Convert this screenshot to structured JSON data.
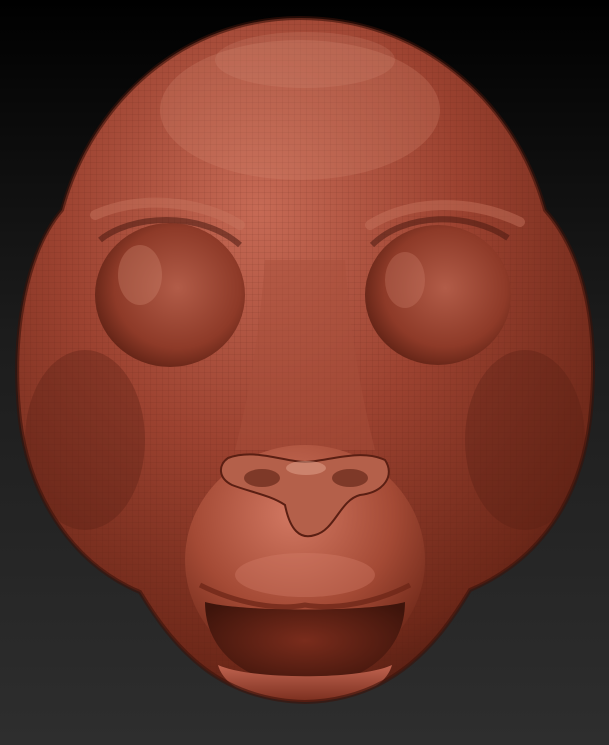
{
  "scene": {
    "subject": "sculpted-head",
    "colors": {
      "background_top": "#000000",
      "background_bottom": "#2e2e2e",
      "clay_base": "#9a3f2c",
      "clay_highlight": "#d27862",
      "clay_shadow": "#4a1a10",
      "wire": "#5a2418"
    }
  }
}
